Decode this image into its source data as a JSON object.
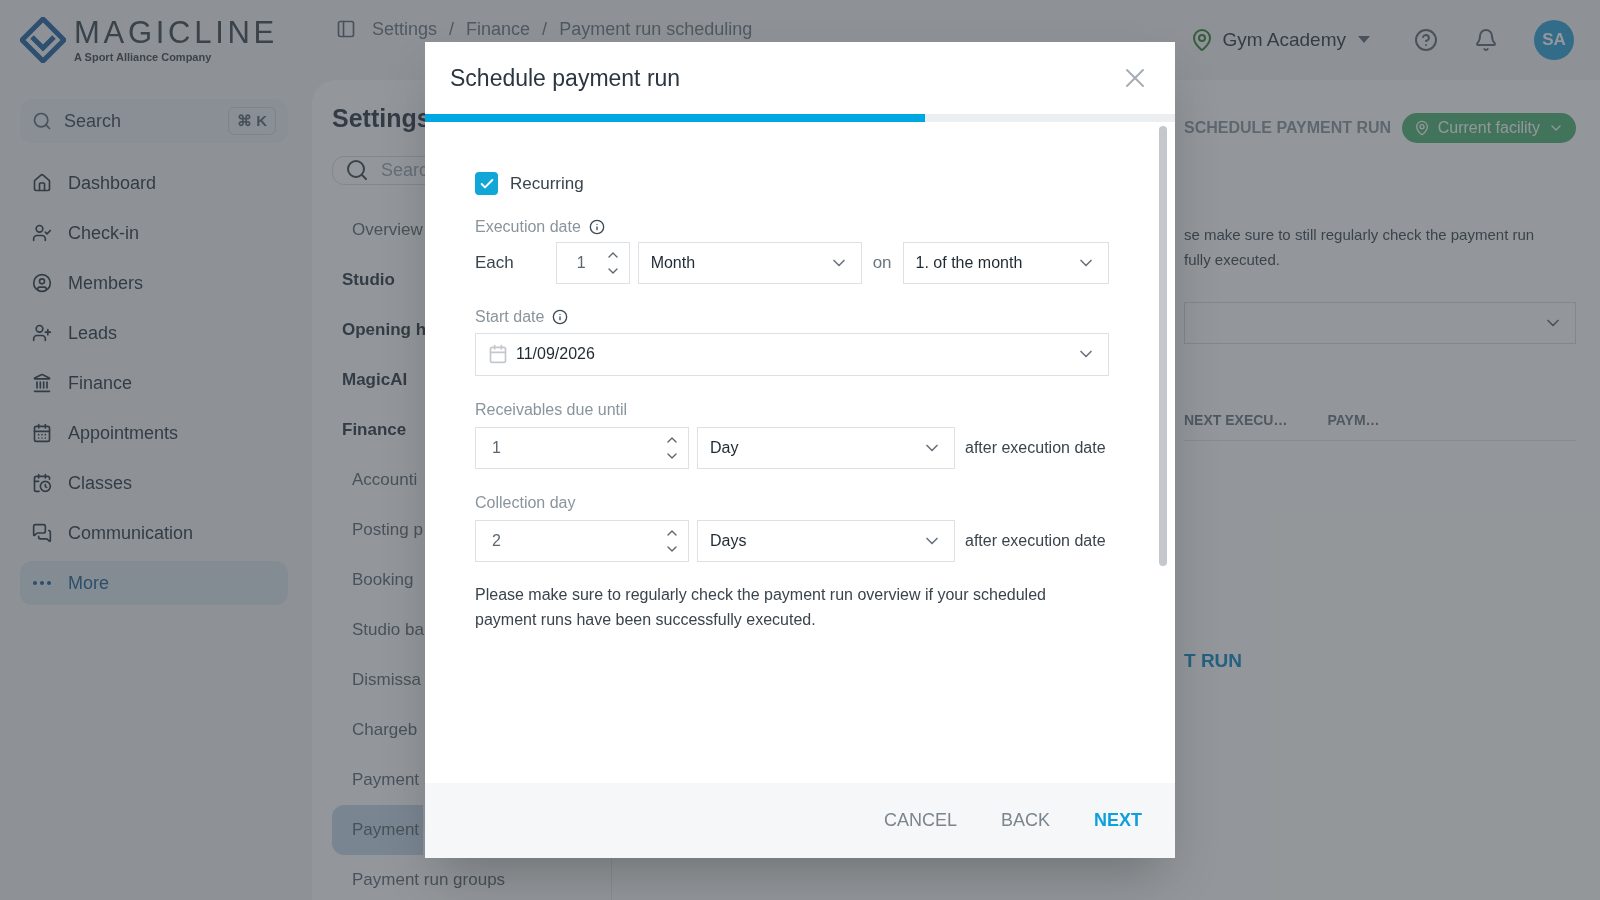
{
  "brand": {
    "name": "MAGICLINE",
    "tagline": "A Sport Alliance Company"
  },
  "breadcrumb": {
    "items": [
      "Settings",
      "Finance",
      "Payment run scheduling"
    ],
    "separator": "/"
  },
  "header": {
    "facility": "Gym Academy",
    "avatar": "SA"
  },
  "sidebar": {
    "search": {
      "placeholder": "Search",
      "shortcut": "⌘ K"
    },
    "items": [
      {
        "label": "Dashboard",
        "selected": false
      },
      {
        "label": "Check-in",
        "selected": false
      },
      {
        "label": "Members",
        "selected": false
      },
      {
        "label": "Leads",
        "selected": false
      },
      {
        "label": "Finance",
        "selected": false
      },
      {
        "label": "Appointments",
        "selected": false
      },
      {
        "label": "Classes",
        "selected": false
      },
      {
        "label": "Communication",
        "selected": false
      },
      {
        "label": "More",
        "selected": true
      }
    ]
  },
  "settings": {
    "title": "Settings",
    "search_placeholder": "Searc",
    "items": [
      {
        "label": "Overview",
        "kind": "link",
        "selected": false
      },
      {
        "label": "Studio",
        "kind": "section",
        "selected": false
      },
      {
        "label": "Opening h",
        "kind": "section",
        "selected": false
      },
      {
        "label": "MagicAI",
        "kind": "section",
        "selected": false
      },
      {
        "label": "Finance",
        "kind": "section",
        "selected": false
      },
      {
        "label": "Accounti",
        "kind": "link",
        "selected": false
      },
      {
        "label": "Posting p",
        "kind": "link",
        "selected": false
      },
      {
        "label": "Booking",
        "kind": "link",
        "selected": false
      },
      {
        "label": "Studio ba",
        "kind": "link",
        "selected": false
      },
      {
        "label": "Dismissa",
        "kind": "link",
        "selected": false
      },
      {
        "label": "Chargeb",
        "kind": "link",
        "selected": false
      },
      {
        "label": "Payment",
        "kind": "link",
        "selected": false
      },
      {
        "label": "Payment",
        "kind": "link",
        "selected": true
      },
      {
        "label": "Payment run groups",
        "kind": "link",
        "selected": false
      }
    ]
  },
  "main": {
    "action": "SCHEDULE PAYMENT RUN",
    "facility_filter": "Current facility",
    "notice": [
      "se make sure to still regularly check the payment run",
      "fully executed."
    ],
    "columns": [
      "NEXT EXECU…",
      "PAYM…"
    ],
    "link": "T RUN"
  },
  "modal": {
    "title": "Schedule payment run",
    "progress": {
      "level": 0.667
    },
    "recurring": {
      "label": "Recurring",
      "checked": true
    },
    "execution": {
      "label": "Execution date",
      "each": "Each",
      "interval": "1",
      "unit": "Month",
      "on": "on",
      "day": "1. of the month"
    },
    "start": {
      "label": "Start date",
      "value": "11/09/2026"
    },
    "receivables": {
      "label": "Receivables due until",
      "value": "1",
      "unit": "Day",
      "suffix": "after execution date"
    },
    "collection": {
      "label": "Collection day",
      "value": "2",
      "unit": "Days",
      "suffix": "after execution date"
    },
    "note": "Please make sure to regularly check the payment run overview if your scheduled payment runs have been successfully executed.",
    "buttons": [
      {
        "label": "CANCEL",
        "kind": "secondary"
      },
      {
        "label": "BACK",
        "kind": "secondary"
      },
      {
        "label": "NEXT",
        "kind": "primary"
      }
    ]
  }
}
